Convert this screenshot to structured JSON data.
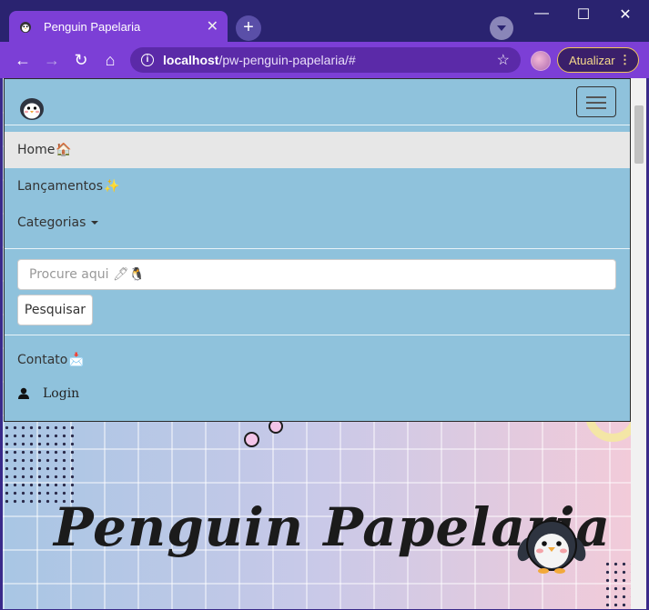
{
  "browser": {
    "tab_title": "Penguin Papelaria",
    "tab_close": "✕",
    "new_tab": "+",
    "url_host": "localhost",
    "url_path": "/pw-penguin-papelaria/#",
    "update_label": "Atualizar",
    "update_dots": "⋮",
    "back": "←",
    "forward": "→",
    "reload": "↻",
    "home": "⌂",
    "star": "☆",
    "minimize": "—",
    "maximize": "☐",
    "close": "✕",
    "accent": "#7c3fd6"
  },
  "nav": {
    "items": [
      {
        "label": "Home",
        "emoji": "🏠"
      },
      {
        "label": "Lançamentos",
        "emoji": "✨"
      },
      {
        "label": "Categorias"
      }
    ],
    "search": {
      "placeholder": "Procure aqui 🖊🐧",
      "button": "Pesquisar"
    },
    "contact": {
      "label": "Contato",
      "emoji": "📩"
    },
    "login": {
      "label": "Login",
      "icon": "user-icon"
    },
    "background": "#8fc2dc"
  },
  "hero": {
    "title": "Penguin  Papelaria"
  }
}
